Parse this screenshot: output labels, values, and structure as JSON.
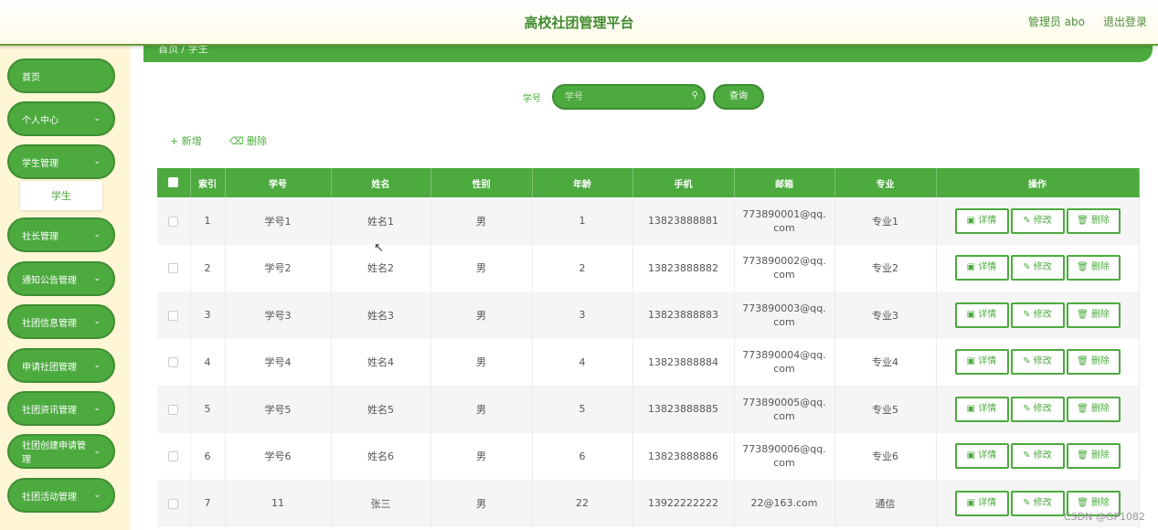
{
  "header": {
    "title": "高校社团管理平台",
    "admin": "管理员 abo",
    "logout": "退出登录"
  },
  "sidebar": {
    "items": [
      {
        "label": "首页",
        "chevron": ""
      },
      {
        "label": "个人中心",
        "chevron": "⌄"
      },
      {
        "label": "学生管理",
        "chevron": "⌄"
      },
      {
        "label": "社长管理",
        "chevron": "⌄"
      },
      {
        "label": "通知公告管理",
        "chevron": "⌄"
      },
      {
        "label": "社团信息管理",
        "chevron": "⌄"
      },
      {
        "label": "申请社团管理",
        "chevron": "⌄"
      },
      {
        "label": "社团资讯管理",
        "chevron": "⌄"
      },
      {
        "label": "社团创建申请管理",
        "chevron": "⌄"
      },
      {
        "label": "社团活动管理",
        "chevron": "⌄"
      }
    ],
    "submenu": "学生"
  },
  "breadcrumb": "首页 / 学生",
  "search": {
    "label": "学号",
    "placeholder": "学号",
    "button": "查询"
  },
  "actions": {
    "add": "+ 新增",
    "delete": "⌫ 删除"
  },
  "table": {
    "headers": [
      "",
      "索引",
      "学号",
      "姓名",
      "性别",
      "年龄",
      "手机",
      "邮箱",
      "专业",
      "操作"
    ],
    "rows": [
      {
        "index": "1",
        "xuehao": "学号1",
        "name": "姓名1",
        "gender": "男",
        "age": "1",
        "phone": "13823888881",
        "email": "773890001@qq.com",
        "major": "专业1"
      },
      {
        "index": "2",
        "xuehao": "学号2",
        "name": "姓名2",
        "gender": "男",
        "age": "2",
        "phone": "13823888882",
        "email": "773890002@qq.com",
        "major": "专业2"
      },
      {
        "index": "3",
        "xuehao": "学号3",
        "name": "姓名3",
        "gender": "男",
        "age": "3",
        "phone": "13823888883",
        "email": "773890003@qq.com",
        "major": "专业3"
      },
      {
        "index": "4",
        "xuehao": "学号4",
        "name": "姓名4",
        "gender": "男",
        "age": "4",
        "phone": "13823888884",
        "email": "773890004@qq.com",
        "major": "专业4"
      },
      {
        "index": "5",
        "xuehao": "学号5",
        "name": "姓名5",
        "gender": "男",
        "age": "5",
        "phone": "13823888885",
        "email": "773890005@qq.com",
        "major": "专业5"
      },
      {
        "index": "6",
        "xuehao": "学号6",
        "name": "姓名6",
        "gender": "男",
        "age": "6",
        "phone": "13823888886",
        "email": "773890006@qq.com",
        "major": "专业6"
      },
      {
        "index": "7",
        "xuehao": "11",
        "name": "张三",
        "gender": "男",
        "age": "22",
        "phone": "13922222222",
        "email": "22@163.com",
        "major": "通信"
      }
    ],
    "op_buttons": {
      "detail": "▣ 详情",
      "edit": "✎ 修改",
      "delete": "🗑 删除"
    }
  },
  "watermark": "CSDN @GP1082",
  "colors": {
    "accent": "#4caa3f",
    "sidebar_bg": "#fff6d5",
    "header_text": "#3f8a2e"
  }
}
